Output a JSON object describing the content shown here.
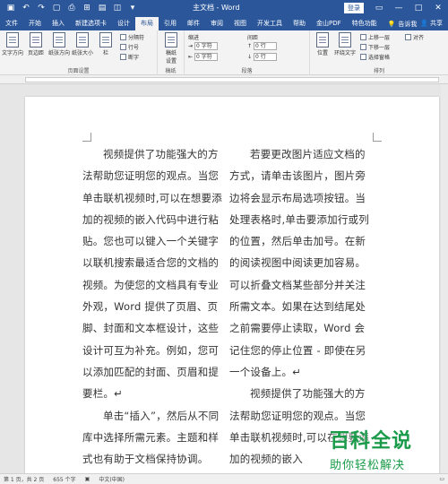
{
  "titlebar": {
    "doc_title": "主文档 - Word",
    "login": "登录",
    "qat": [
      "save-icon",
      "undo-icon",
      "redo-icon",
      "new-doc-icon",
      "print-icon",
      "table-icon",
      "layout-icon",
      "shapes-icon",
      "customize-icon"
    ]
  },
  "tabs": [
    "文件",
    "开始",
    "插入",
    "新建选项卡",
    "设计",
    "布局",
    "引用",
    "邮件",
    "审阅",
    "视图",
    "开发工具",
    "帮助",
    "金山PDF",
    "特色功能"
  ],
  "tabs_right": {
    "tell": "告诉我",
    "share": "共享"
  },
  "ribbon": {
    "text_dir": "文字方向",
    "margins": "页边距",
    "orientation": "纸张方向",
    "size": "纸张大小",
    "columns": "栏",
    "breaks": "分隔符",
    "line_numbers": "行号",
    "hyphenation": "断字",
    "page_setup": "页面设置",
    "draft_settings": "稿纸\n设置",
    "draft": "稿纸",
    "indent": "缩进",
    "spacing": "间距",
    "indent_left": "0 字符",
    "indent_right": "0 字符",
    "spacing_before": "0 行",
    "spacing_after": "0 行",
    "paragraph": "段落",
    "position": "位置",
    "wrap": "环绕文字",
    "bring_forward": "上移一层",
    "send_backward": "下移一层",
    "selection_pane": "选择窗格",
    "align": "对齐",
    "arrange": "排列"
  },
  "doc": {
    "left": [
      "视频提供了功能强大的方法帮助您证明您的观点。当您单击联机视频时,可以在想要添加的视频的嵌入代码中进行粘贴。您也可以键入一个关键字以联机搜索最适合您的文档的视频。为使您的文档具有专业外观，Word 提供了页眉、页脚、封面和文本框设计，这些设计可互为补充。例如，您可以添加匹配的封面、页眉和提要栏。↵",
      "单击“插入”，然后从不同库中选择所需元素。主题和样式也有助于文档保持协调。"
    ],
    "right": [
      "若要更改图片适应文档的方式，请单击该图片，图片旁边将会显示布局选项按钮。当处理表格时,单击要添加行或列的位置，然后单击加号。在新的阅读视图中阅读更加容易。可以折叠文档某些部分并关注所需文本。如果在达到结尾处之前需要停止读取，Word 会记住您的停止位置 - 即使在另一个设备上。↵",
      "视频提供了功能强大的方法帮助您证明您的观点。当您单击联机视频时,可以在想要添加的视频的嵌入"
    ]
  },
  "status": {
    "page": "第 1 页，共 2 页",
    "words": "655 个字",
    "lang": "中文(中国)"
  },
  "watermark": {
    "main": "百科全说",
    "sub": "助你轻松解决"
  }
}
